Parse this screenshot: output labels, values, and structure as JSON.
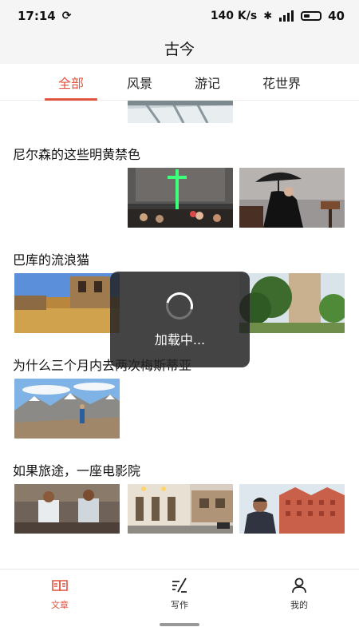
{
  "status_bar": {
    "time": "17:14",
    "network_speed": "140 K/s",
    "battery": "40",
    "battery_level": 0.4
  },
  "header": {
    "title": "古今"
  },
  "tabs": [
    {
      "label": "全部",
      "active": true
    },
    {
      "label": "风景",
      "active": false
    },
    {
      "label": "游记",
      "active": false
    },
    {
      "label": "花世界",
      "active": false
    }
  ],
  "articles": [
    {
      "title": "尼尔森的这些明黄禁色",
      "images": [
        "church-interior-cross-photo",
        "woman-with-umbrella-photo"
      ]
    },
    {
      "title": "巴库的流浪猫",
      "images": [
        "old-town-street-photo",
        "stone-tower-trees-photo"
      ]
    },
    {
      "title": "为什么三个月内去两次梅斯蒂亚",
      "images": [
        "mountain-hiker-photo"
      ]
    },
    {
      "title": "如果旅途，一座电影院",
      "images": [
        "boys-sitting-photo",
        "lit-street-building-photo",
        "pink-palace-man-photo"
      ]
    }
  ],
  "loading": {
    "text": "加载中..."
  },
  "bottom_nav": [
    {
      "label": "文章",
      "icon": "book-icon",
      "active": true
    },
    {
      "label": "写作",
      "icon": "write-icon",
      "active": false
    },
    {
      "label": "我的",
      "icon": "user-icon",
      "active": false
    }
  ],
  "colors": {
    "accent": "#e0533e",
    "header_bg": "#f5f5f5"
  }
}
